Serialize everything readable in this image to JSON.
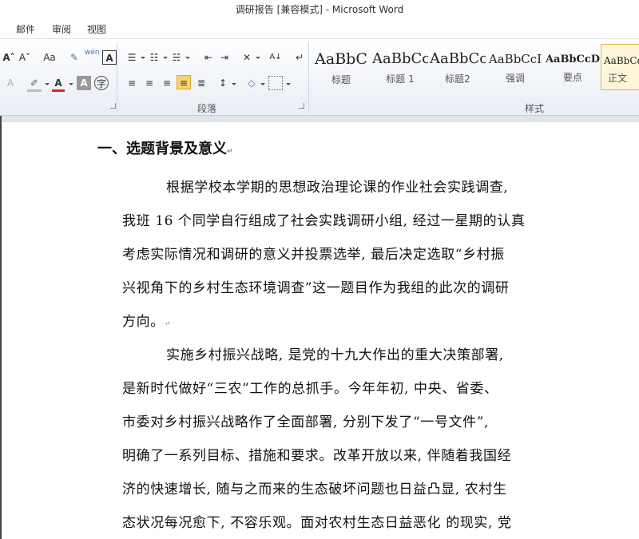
{
  "window": {
    "title": "调研报告 [兼容模式] - Microsoft Word"
  },
  "tabs": [
    {
      "label": "邮件"
    },
    {
      "label": "审阅"
    },
    {
      "label": "视图"
    }
  ],
  "ribbon": {
    "groups": {
      "paragraph": "段落",
      "styles": "样式"
    },
    "font_row1": [
      "A˄",
      "A˅",
      "Aa",
      "wén",
      "A"
    ],
    "styles": [
      {
        "preview": "AaBbC",
        "name": "标题"
      },
      {
        "preview": "AaBbCc",
        "name": "标题 1"
      },
      {
        "preview": "AaBbCc",
        "name": "标题2"
      },
      {
        "preview": "AaBbCcI",
        "name": "强调"
      },
      {
        "preview": "AaBbCcD",
        "name": "要点"
      },
      {
        "preview": "AaBbCc",
        "name": "正文"
      }
    ]
  },
  "document": {
    "heading": "一、选题背景及意义",
    "paragraph1": [
      "根据学校本学期的思想政治理论课的作业社会实践调查,",
      "我班 16 个同学自行组成了社会实践调研小组, 经过一星期的认真",
      "考虑实际情况和调研的意义并投票选举, 最后决定选取“乡村振",
      "兴视角下的乡村生态环境调查”这一题目作为我组的此次的调研",
      "方向。"
    ],
    "paragraph2": [
      "实施乡村振兴战略, 是党的十九大作出的重大决策部署,",
      "是新时代做好“三农”工作的总抓手。今年年初, 中央、省委、",
      "市委对乡村振兴战略作了全面部署, 分别下发了“一号文件”,",
      "明确了一系列目标、措施和要求。改革开放以来, 伴随着我国经",
      "济的快速增长, 随与之而来的生态破坏问题也日益凸显, 农村生",
      "态状况每况愈下, 不容乐观。面对农村生态日益恶化  的现实, 党"
    ]
  }
}
